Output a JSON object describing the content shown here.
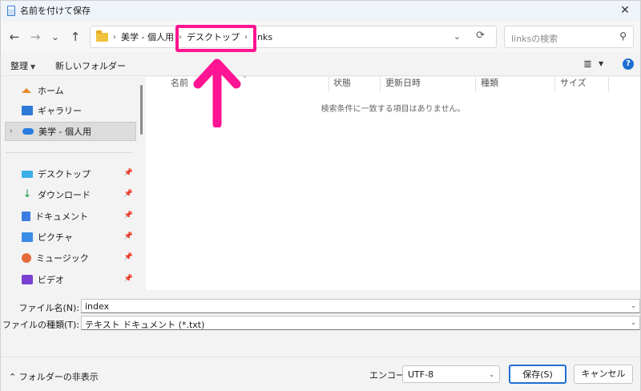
{
  "window": {
    "title": "名前を付けて保存",
    "close": "✕"
  },
  "nav": {
    "back": "←",
    "forward": "→",
    "recent": "⌄",
    "up": "↑",
    "breadcrumb": [
      "美学 - 個人用",
      "デスクトップ",
      "links"
    ],
    "separator": "›",
    "search_placeholder": "linksの検索"
  },
  "toolbar": {
    "organize": "整理",
    "new_folder": "新しいフォルダー"
  },
  "sidebar": {
    "items": [
      {
        "label": "ホーム",
        "icon": "home-icon"
      },
      {
        "label": "ギャラリー",
        "icon": "gallery-icon"
      },
      {
        "label": "美学 - 個人用",
        "icon": "onedrive-icon",
        "selected": true
      },
      {
        "label": "デスクトップ",
        "icon": "desktop-icon",
        "pinned": true
      },
      {
        "label": "ダウンロード",
        "icon": "download-icon",
        "pinned": true
      },
      {
        "label": "ドキュメント",
        "icon": "documents-icon",
        "pinned": true
      },
      {
        "label": "ピクチャ",
        "icon": "pictures-icon",
        "pinned": true
      },
      {
        "label": "ミュージック",
        "icon": "music-icon",
        "pinned": true
      },
      {
        "label": "ビデオ",
        "icon": "video-icon",
        "pinned": true
      }
    ]
  },
  "content": {
    "columns": [
      "名前",
      "状態",
      "更新日時",
      "種類",
      "サイズ"
    ],
    "empty_message": "検索条件に一致する項目はありません。"
  },
  "form": {
    "filename_label": "ファイル名(N):",
    "filename_value": "index",
    "filetype_label": "ファイルの種類(T):",
    "filetype_value": "テキスト ドキュメント (*.txt)"
  },
  "footer": {
    "hide_folders": "フォルダーの非表示",
    "encoding_label": "エンコード:",
    "encoding_value": "UTF-8",
    "save_button": "保存(S)",
    "cancel_button": "キャンセル"
  },
  "colors": {
    "highlight": "#ff1493",
    "accent": "#1f6fd1"
  }
}
